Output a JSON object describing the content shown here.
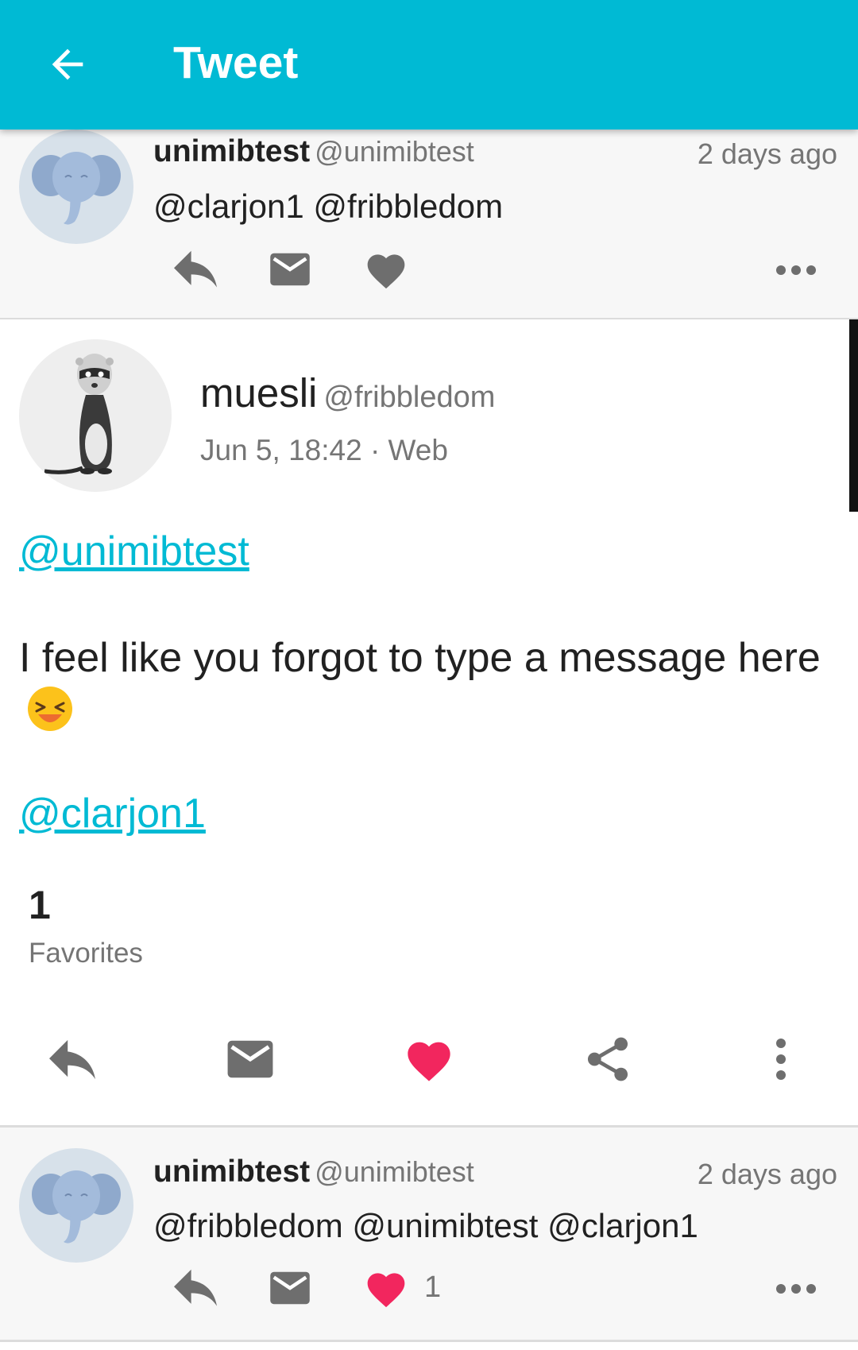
{
  "app_bar": {
    "title": "Tweet"
  },
  "reply_above": {
    "username": "unimibtest",
    "handle": "@unimibtest",
    "time": "2 days ago",
    "text": "@clarjon1 @fribbledom"
  },
  "main_tweet": {
    "display_name": "muesli",
    "handle": "@fribbledom",
    "meta": "Jun 5, 18:42 · Web",
    "mention_top": "@unimibtest",
    "text": "I feel like you forgot to type a message here",
    "mention_bottom": "@clarjon1",
    "favorites_count": "1",
    "favorites_label": "Favorites"
  },
  "reply_below": {
    "username": "unimibtest",
    "handle": "@unimibtest",
    "time": "2 days ago",
    "text": "@fribbledom @unimibtest @clarjon1",
    "like_count": "1"
  },
  "colors": {
    "accent": "#00BAD4",
    "like_active": "#F2265E",
    "icon_grey": "#6e6e6e",
    "secondary_text": "#757575"
  },
  "icons": {
    "back": "arrow-left-icon",
    "reply": "reply-icon",
    "message": "envelope-icon",
    "like": "heart-icon",
    "share": "share-icon",
    "more": "more-icon"
  }
}
